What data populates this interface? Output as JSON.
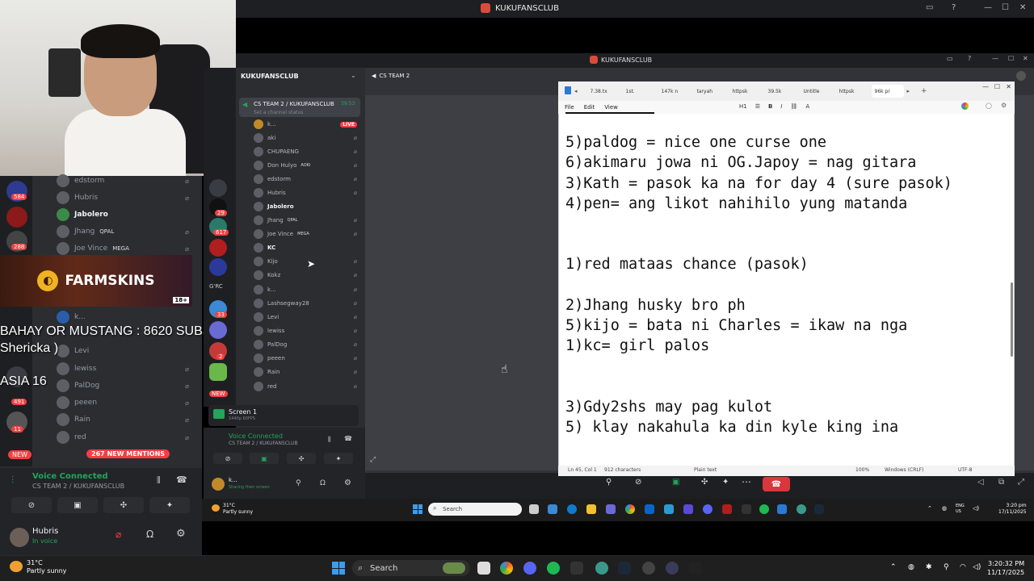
{
  "window": {
    "title": "KUKUFANSCLUB"
  },
  "webcam": {
    "label": "streamer webcam"
  },
  "left_discord": {
    "badges": {
      "b1": "584",
      "b2": "288",
      "b3": "491",
      "b4": "11"
    },
    "members": [
      {
        "name": "edstorm"
      },
      {
        "name": "Hubris"
      },
      {
        "name": "Jabolero"
      },
      {
        "name": "Jhang",
        "tag": "QPAL"
      },
      {
        "name": "Joe Vince",
        "tag": "MEGA"
      },
      {
        "name": "k..."
      },
      {
        "name": "Levi"
      },
      {
        "name": "lewiss"
      },
      {
        "name": "PalDog"
      },
      {
        "name": "peeen"
      },
      {
        "name": "Rain"
      },
      {
        "name": "red"
      }
    ],
    "new_badge": "NEW",
    "mentions": "267 NEW MENTIONS",
    "voice_connected": "Voice Connected",
    "voice_channel": "CS TEAM 2 / KUKUFANSCLUB",
    "user_name": "Hubris",
    "user_status": "In voice",
    "weather_temp": "31°C",
    "weather_desc": "Partly sunny"
  },
  "ad": {
    "brand": "FARMSKINS",
    "age": "18+"
  },
  "overlay": {
    "line1": "BAHAY OR MUSTANG : 8620 SUBS",
    "line2": "Shericka )",
    "line3": "ASIA 16"
  },
  "inner_discord": {
    "server_name": "KUKUFANSCLUB",
    "voice_channel": "CS TEAM 2 / KUKUFANSCLUB",
    "channel_status": "Set a channel status",
    "timer": "39:53",
    "live": "LIVE",
    "members": [
      {
        "name": "k..."
      },
      {
        "name": "aki"
      },
      {
        "name": "CHUPAENG"
      },
      {
        "name": "Don Hulyo",
        "tag": "AOKI"
      },
      {
        "name": "edstorm"
      },
      {
        "name": "Hubris"
      },
      {
        "name": "Jabolero"
      },
      {
        "name": "Jhang",
        "tag": "QPAL"
      },
      {
        "name": "Joe Vince",
        "tag": "MEGA"
      },
      {
        "name": "KC"
      },
      {
        "name": "Kijo"
      },
      {
        "name": "Kokz"
      },
      {
        "name": "k..."
      },
      {
        "name": "Lashsegway28"
      },
      {
        "name": "Levi"
      },
      {
        "name": "lewiss"
      },
      {
        "name": "PalDog"
      },
      {
        "name": "peeen"
      },
      {
        "name": "Rain"
      },
      {
        "name": "red"
      }
    ],
    "server_badges": {
      "s1": "29",
      "s2": "617",
      "s3": "33",
      "s4": "2"
    },
    "new_badge": "NEW",
    "stage_header": "CS TEAM 2",
    "screen_title": "Screen 1",
    "screen_sub": "1440p 60FPS",
    "voice_connected": "Voice Connected",
    "user_name": "k...",
    "user_status": "Sharing their screen"
  },
  "notepad": {
    "tabs": [
      "7.38.tx",
      "1st.",
      "147k n",
      "taryah",
      "httpsk",
      "39.5k",
      "Untitle",
      "httpsk",
      "96k pr"
    ],
    "menu": [
      "File",
      "Edit",
      "View"
    ],
    "heading_tool": "H1",
    "lines": [
      "",
      "5)paldog = nice one curse one",
      "6)akimaru jowa ni OG.Japoy = nag gitara",
      "3)Kath = pasok ka na for day 4 (sure pasok)",
      "4)pen= ang likot nahihilo yung matanda",
      "",
      "",
      "1)red mataas chance (pasok)",
      "",
      "2)Jhang husky bro ph",
      "5)kijo = bata ni Charles = ikaw na nga",
      "1)kc= girl palos",
      "",
      "",
      "3)Gdy2shs may pag kulot",
      "5) klay nakahula ka din kyle king ina"
    ],
    "status": {
      "position": "Ln 45, Col 1",
      "chars": "912 characters",
      "format": "Plain text",
      "zoom": "100%",
      "line_endings": "Windows (CRLF)",
      "encoding": "UTF-8"
    }
  },
  "inner_taskbar": {
    "weather_temp": "31°C",
    "weather_desc": "Partly sunny",
    "search": "Search",
    "lang": "ENG",
    "lang2": "US",
    "time": "3:20 pm",
    "date": "17/11/2025"
  },
  "taskbar": {
    "weather_temp": "31°C",
    "weather_desc": "Partly sunny",
    "search": "Search",
    "time": "3:20:32 PM",
    "date": "11/17/2025"
  },
  "colors": {
    "accent_green": "#23a55a",
    "danger_red": "#f23f42",
    "discord_bg": "#313338"
  }
}
